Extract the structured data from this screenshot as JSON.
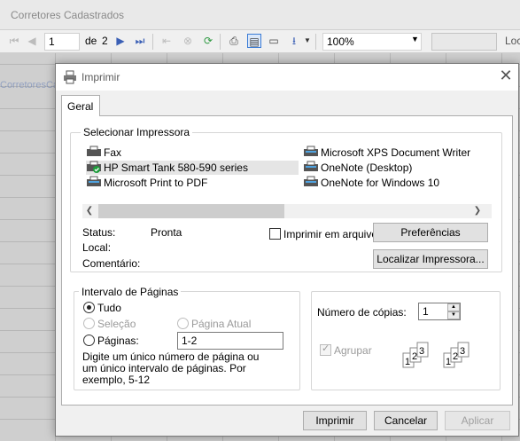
{
  "app": {
    "title": "Corretores Cadastrados",
    "ghost_text": "CorretoresCa",
    "toolbar": {
      "page": "1",
      "page_of_label": "de",
      "page_total": "2",
      "zoom": "100%",
      "search_placeholder": "",
      "right_label": "Loc"
    }
  },
  "dialog": {
    "title": "Imprimir",
    "tabs": [
      {
        "label": "Geral",
        "active": true
      }
    ],
    "select_printer": {
      "legend": "Selecionar Impressora",
      "printers": [
        {
          "name": "Fax",
          "selected": false
        },
        {
          "name": "HP Smart Tank 580-590 series",
          "selected": true,
          "default": true
        },
        {
          "name": "Microsoft Print to PDF",
          "selected": false
        },
        {
          "name": "Microsoft XPS Document Writer",
          "selected": false
        },
        {
          "name": "OneNote (Desktop)",
          "selected": false
        },
        {
          "name": "OneNote for Windows 10",
          "selected": false
        }
      ],
      "status_label": "Status:",
      "status_value": "Pronta",
      "location_label": "Local:",
      "location_value": "",
      "comment_label": "Comentário:",
      "comment_value": "",
      "print_to_file_label": "Imprimir em arquivo",
      "print_to_file_checked": false,
      "preferences_label": "Preferências",
      "find_printer_label": "Localizar Impressora..."
    },
    "page_range": {
      "legend": "Intervalo de Páginas",
      "all_label": "Tudo",
      "selection_label": "Seleção",
      "current_page_label": "Página Atual",
      "pages_label": "Páginas:",
      "pages_value": "1-2",
      "hint": "Digite um único número de página ou um único intervalo de páginas. Por exemplo, 5-12",
      "selected": "all"
    },
    "copies": {
      "label": "Número de cópias:",
      "value": "1",
      "collate_label": "Agrupar",
      "collate_checked": true,
      "collate_enabled": false
    },
    "buttons": {
      "print": "Imprimir",
      "cancel": "Cancelar",
      "apply": "Aplicar"
    }
  },
  "colors": {
    "accent": "#3a5fb5",
    "selection_bg": "#e5e5e5",
    "default_printer_badge": "#1e9e3c"
  }
}
